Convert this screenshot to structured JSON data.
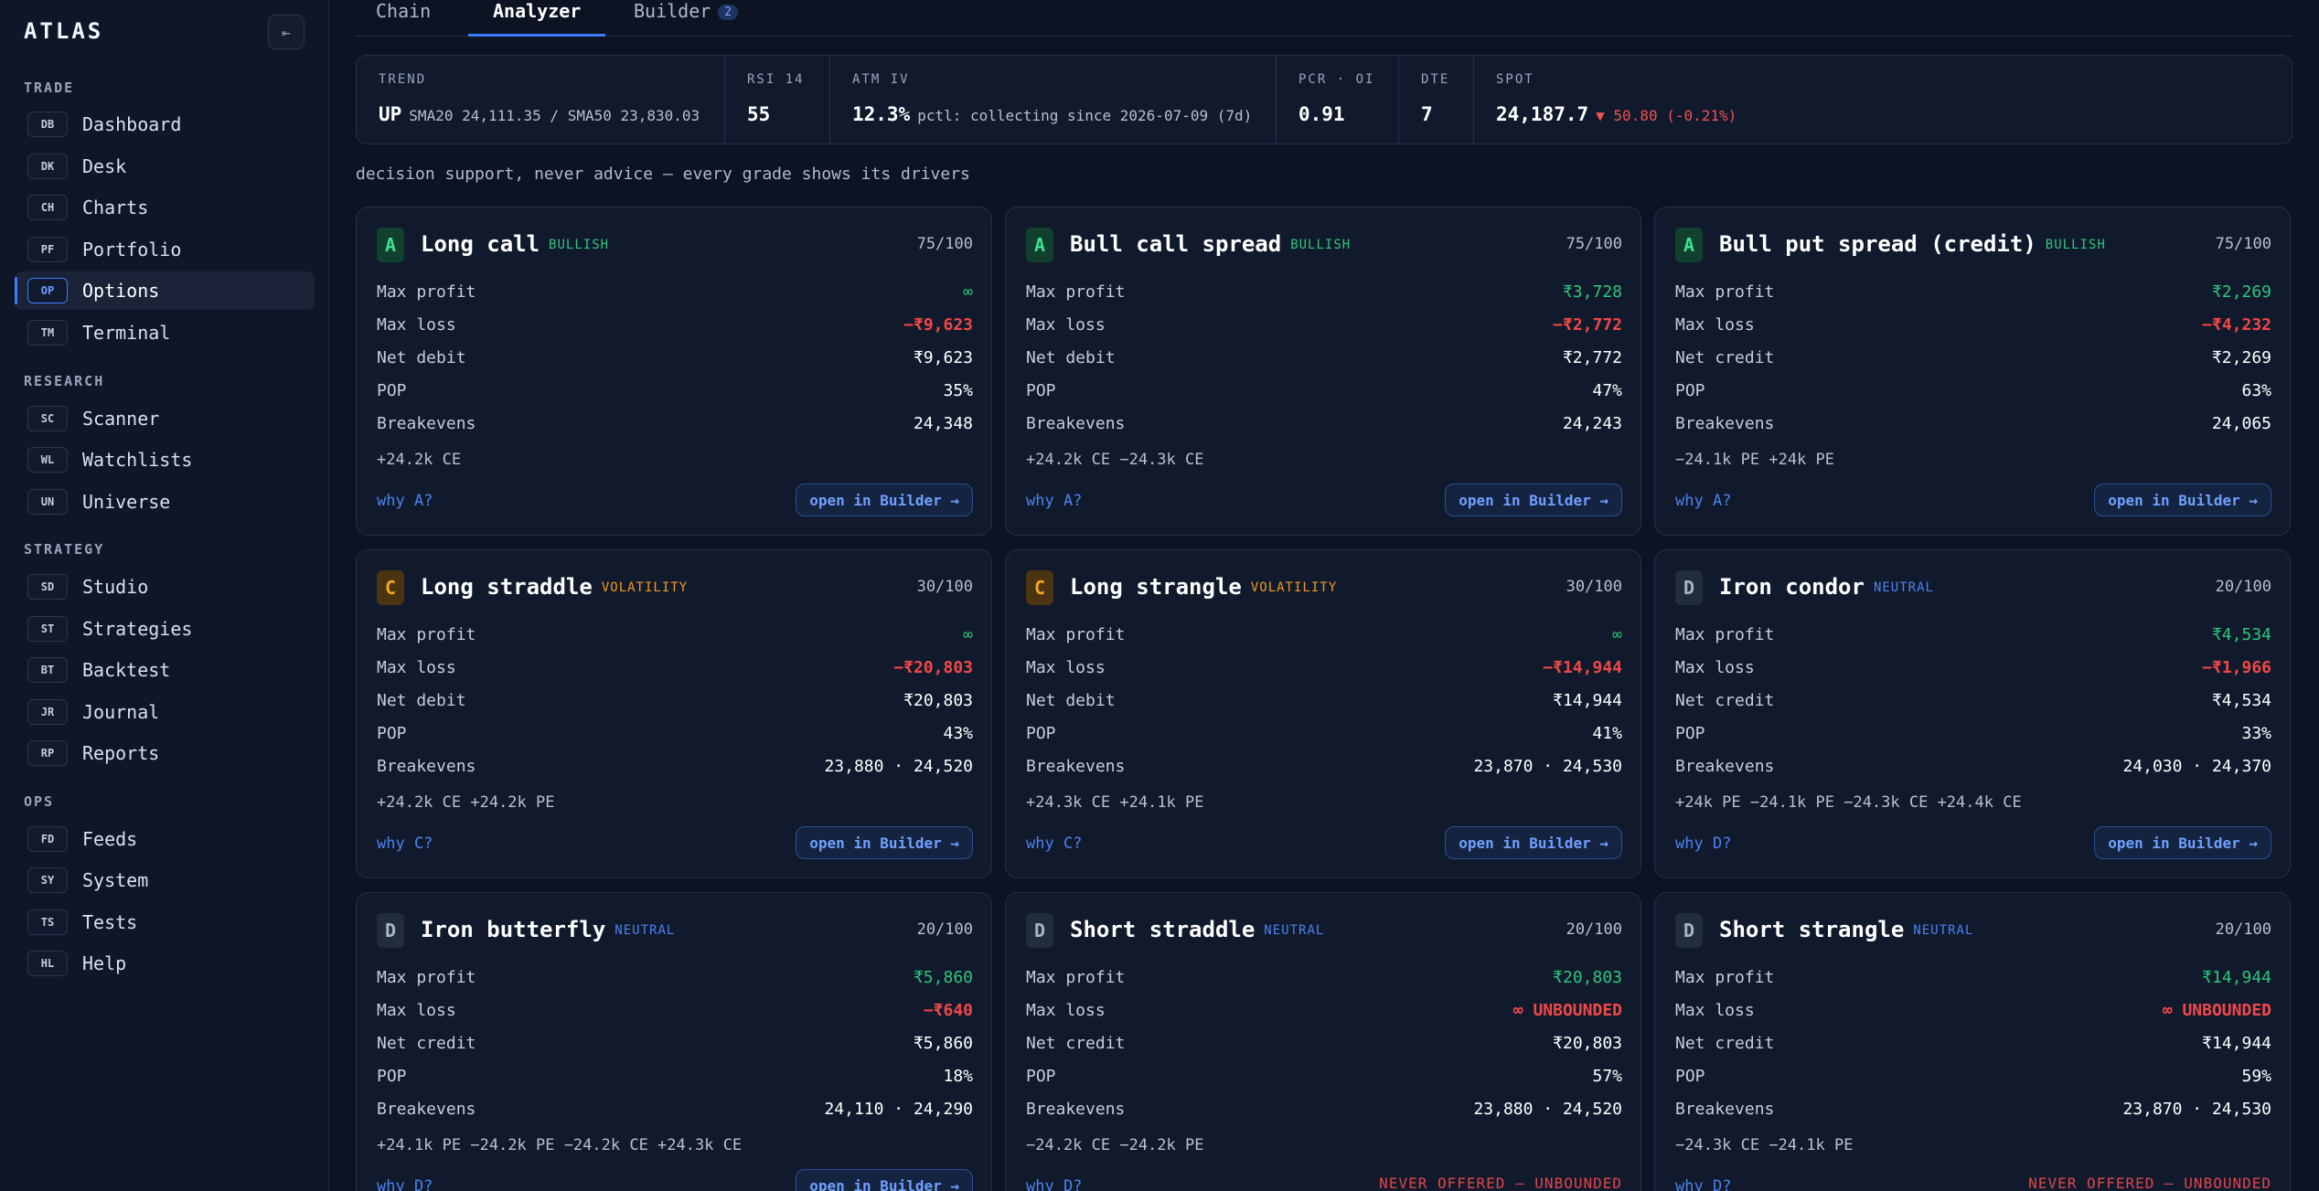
{
  "sidebar": {
    "brand": "ATLAS",
    "collapse_icon": "⇤",
    "sections": [
      {
        "title": "TRADE",
        "items": [
          {
            "code": "DB",
            "label": "Dashboard"
          },
          {
            "code": "DK",
            "label": "Desk"
          },
          {
            "code": "CH",
            "label": "Charts"
          },
          {
            "code": "PF",
            "label": "Portfolio"
          },
          {
            "code": "OP",
            "label": "Options"
          },
          {
            "code": "TM",
            "label": "Terminal"
          }
        ]
      },
      {
        "title": "RESEARCH",
        "items": [
          {
            "code": "SC",
            "label": "Scanner"
          },
          {
            "code": "WL",
            "label": "Watchlists"
          },
          {
            "code": "UN",
            "label": "Universe"
          }
        ]
      },
      {
        "title": "STRATEGY",
        "items": [
          {
            "code": "SD",
            "label": "Studio"
          },
          {
            "code": "ST",
            "label": "Strategies"
          },
          {
            "code": "BT",
            "label": "Backtest"
          },
          {
            "code": "JR",
            "label": "Journal"
          },
          {
            "code": "RP",
            "label": "Reports"
          }
        ]
      },
      {
        "title": "OPS",
        "items": [
          {
            "code": "FD",
            "label": "Feeds"
          },
          {
            "code": "SY",
            "label": "System"
          },
          {
            "code": "TS",
            "label": "Tests"
          },
          {
            "code": "HL",
            "label": "Help"
          }
        ]
      }
    ]
  },
  "tabs": {
    "chain": "Chain",
    "analyzer": "Analyzer",
    "builder": "Builder",
    "builder_badge": "2"
  },
  "stats": {
    "trend": {
      "label": "TREND",
      "value": "UP",
      "sub": "SMA20 24,111.35 / SMA50 23,830.03"
    },
    "rsi": {
      "label": "RSI 14",
      "value": "55"
    },
    "atm_iv": {
      "label": "ATM IV",
      "value": "12.3%",
      "sub": "pctl: collecting since 2026-07-09 (7d)"
    },
    "pcr": {
      "label": "PCR · OI",
      "value": "0.91"
    },
    "dte": {
      "label": "DTE",
      "value": "7"
    },
    "spot": {
      "label": "SPOT",
      "value": "24,187.7",
      "change": "▼ 50.80 (-0.21%)"
    }
  },
  "disclaimer": "decision support, never advice — every grade shows its drivers",
  "labels": {
    "max_profit": "Max profit",
    "max_loss": "Max loss",
    "pop": "POP",
    "breakevens": "Breakevens",
    "open_builder": "open in Builder →"
  },
  "cards": [
    {
      "grade": "A",
      "title": "Long call",
      "tag": "BULLISH",
      "score": "75/100",
      "max_profit": "∞",
      "max_loss": "−₹9,623",
      "net_label": "Net debit",
      "net_value": "₹9,623",
      "pop": "35%",
      "breakevens": "24,348",
      "legs": "+24.2k CE",
      "why": "why A?"
    },
    {
      "grade": "A",
      "title": "Bull call spread",
      "tag": "BULLISH",
      "score": "75/100",
      "max_profit": "₹3,728",
      "max_loss": "−₹2,772",
      "net_label": "Net debit",
      "net_value": "₹2,772",
      "pop": "47%",
      "breakevens": "24,243",
      "legs": "+24.2k CE −24.3k CE",
      "why": "why A?"
    },
    {
      "grade": "A",
      "title": "Bull put spread (credit)",
      "tag": "BULLISH",
      "score": "75/100",
      "max_profit": "₹2,269",
      "max_loss": "−₹4,232",
      "net_label": "Net credit",
      "net_value": "₹2,269",
      "pop": "63%",
      "breakevens": "24,065",
      "legs": "−24.1k PE +24k PE",
      "why": "why A?"
    },
    {
      "grade": "C",
      "title": "Long straddle",
      "tag": "VOLATILITY",
      "score": "30/100",
      "max_profit": "∞",
      "max_loss": "−₹20,803",
      "net_label": "Net debit",
      "net_value": "₹20,803",
      "pop": "43%",
      "breakevens": "23,880 · 24,520",
      "legs": "+24.2k CE +24.2k PE",
      "why": "why C?"
    },
    {
      "grade": "C",
      "title": "Long strangle",
      "tag": "VOLATILITY",
      "score": "30/100",
      "max_profit": "∞",
      "max_loss": "−₹14,944",
      "net_label": "Net debit",
      "net_value": "₹14,944",
      "pop": "41%",
      "breakevens": "23,870 · 24,530",
      "legs": "+24.3k CE +24.1k PE",
      "why": "why C?"
    },
    {
      "grade": "D",
      "title": "Iron condor",
      "tag": "NEUTRAL",
      "score": "20/100",
      "max_profit": "₹4,534",
      "max_loss": "−₹1,966",
      "net_label": "Net credit",
      "net_value": "₹4,534",
      "pop": "33%",
      "breakevens": "24,030 · 24,370",
      "legs": "+24k PE −24.1k PE −24.3k CE +24.4k CE",
      "why": "why D?"
    },
    {
      "grade": "D",
      "title": "Iron butterfly",
      "tag": "NEUTRAL",
      "score": "20/100",
      "max_profit": "₹5,860",
      "max_loss": "−₹640",
      "net_label": "Net credit",
      "net_value": "₹5,860",
      "pop": "18%",
      "breakevens": "24,110 · 24,290",
      "legs": "+24.1k PE −24.2k PE −24.2k CE +24.3k CE",
      "why": "why D?"
    },
    {
      "grade": "D",
      "title": "Short straddle",
      "tag": "NEUTRAL",
      "score": "20/100",
      "max_profit": "₹20,803",
      "max_loss": "∞ UNBOUNDED",
      "net_label": "Net credit",
      "net_value": "₹20,803",
      "pop": "57%",
      "breakevens": "23,880 · 24,520",
      "legs": "−24.2k CE −24.2k PE",
      "why": "why D?",
      "never_offered": "NEVER OFFERED — UNBOUNDED"
    },
    {
      "grade": "D",
      "title": "Short strangle",
      "tag": "NEUTRAL",
      "score": "20/100",
      "max_profit": "₹14,944",
      "max_loss": "∞ UNBOUNDED",
      "net_label": "Net credit",
      "net_value": "₹14,944",
      "pop": "59%",
      "breakevens": "23,870 · 24,530",
      "legs": "−24.3k CE −24.1k PE",
      "why": "why D?",
      "never_offered": "NEVER OFFERED — UNBOUNDED"
    }
  ],
  "colors": {
    "accent": "#3d7cff",
    "green": "#2fc57b",
    "red": "#f04848",
    "volatility": "#f29a1f",
    "neutral": "#4a83f0"
  }
}
